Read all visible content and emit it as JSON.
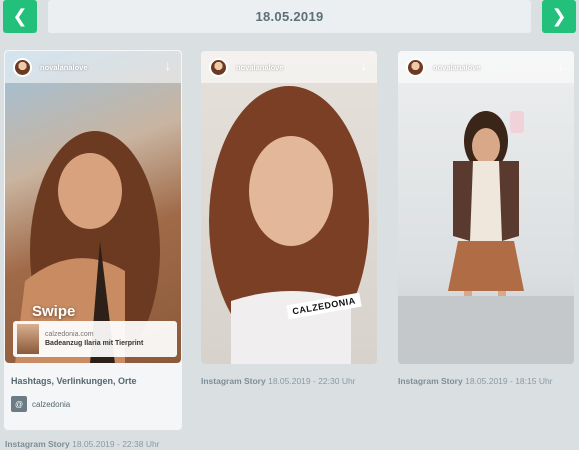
{
  "nav": {
    "prev_icon": "chevron-left-icon",
    "next_icon": "chevron-right-icon",
    "date": "18.05.2019"
  },
  "stories": [
    {
      "username": "novalanalove",
      "swipe_text": "Swipe",
      "link_domain": "calzedonia.com",
      "link_title": "Badeanzug Ilaria mit Tierprint",
      "section_title": "Hashtags, Verlinkungen, Orte",
      "tag_icon": "@",
      "tag_label": "calzedonia",
      "type": "Instagram Story",
      "timestamp": "18.05.2019 - 22:38 Uhr"
    },
    {
      "username": "novalanalove",
      "sticker": "CALZEDONIA",
      "type": "Instagram Story",
      "timestamp": "18.05.2019 - 22:30 Uhr"
    },
    {
      "username": "novalanalove",
      "type": "Instagram Story",
      "timestamp": "18.05.2019 - 18:15 Uhr"
    }
  ],
  "colors": {
    "accent": "#22c07a",
    "background": "#dadfe2",
    "text_muted": "#8a9aa3"
  }
}
